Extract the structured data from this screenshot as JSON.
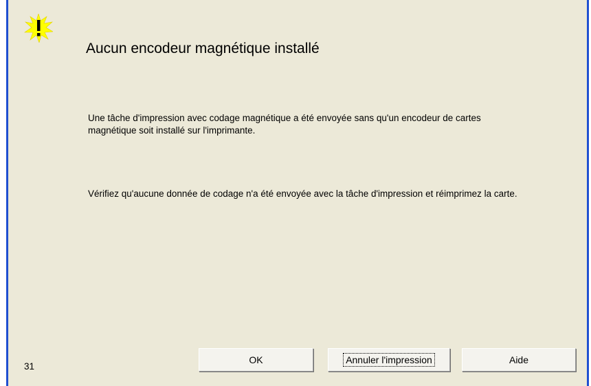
{
  "dialog": {
    "title": "Aucun encodeur magnétique installé",
    "message_1": "Une tâche d'impression avec codage magnétique a été envoyée sans qu'un encodeur de cartes magnétique soit installé sur l'imprimante.",
    "message_2": "Vérifiez qu'aucune donnée de codage n'a été envoyée avec la tâche d'impression et réimprimez la carte.",
    "error_code": "31",
    "icon": "warning-icon"
  },
  "buttons": {
    "ok_label": "OK",
    "cancel_print_label": "Annuler l'impression",
    "help_label": "Aide"
  },
  "colors": {
    "dialog_background": "#ece9d8",
    "frame_border": "#1f4fd1",
    "icon_yellow": "#ffff00"
  }
}
